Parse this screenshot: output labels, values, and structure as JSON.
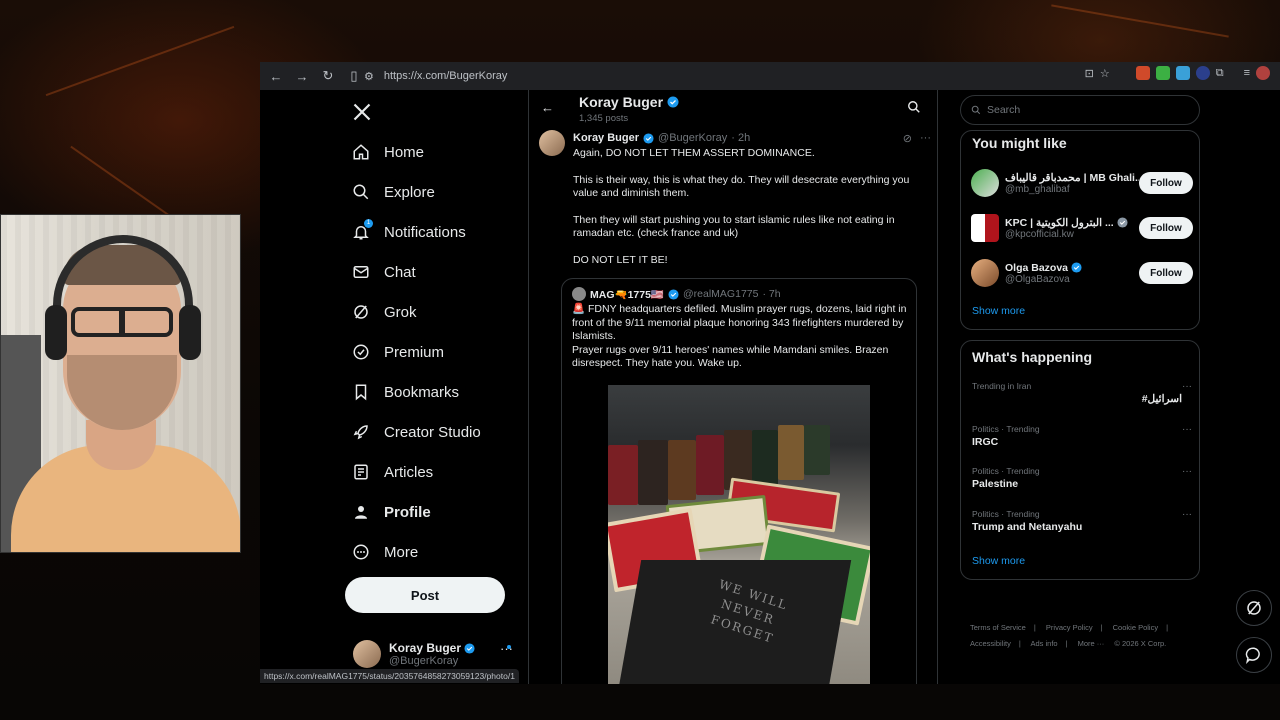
{
  "browser": {
    "url": "https://x.com/BugerKoray",
    "status_url": "https://x.com/realMAG1775/status/2035764858273059123/photo/1"
  },
  "nav": {
    "items": [
      {
        "label": "Home",
        "icon": "home-icon"
      },
      {
        "label": "Explore",
        "icon": "search-icon"
      },
      {
        "label": "Notifications",
        "icon": "bell-icon",
        "badge": "1"
      },
      {
        "label": "Chat",
        "icon": "mail-icon"
      },
      {
        "label": "Grok",
        "icon": "grok-icon"
      },
      {
        "label": "Premium",
        "icon": "verified-icon"
      },
      {
        "label": "Bookmarks",
        "icon": "bookmark-icon"
      },
      {
        "label": "Creator Studio",
        "icon": "rocket-icon"
      },
      {
        "label": "Articles",
        "icon": "article-icon"
      },
      {
        "label": "Profile",
        "icon": "person-icon"
      },
      {
        "label": "More",
        "icon": "more-circle-icon"
      }
    ],
    "post_label": "Post",
    "me": {
      "name": "Koray Buger",
      "handle": "@BugerKoray"
    }
  },
  "profile_header": {
    "name": "Koray Buger",
    "posts": "1,345 posts"
  },
  "tweet": {
    "name": "Koray Buger",
    "handle": "@BugerKoray",
    "time": "· 2h",
    "paragraphs": [
      "Again, DO NOT LET THEM ASSERT DOMINANCE.",
      "This is their way, this is what they do. They will desecrate everything you value and diminish them.",
      "Then they will start pushing you to start islamic rules like not eating in ramadan etc. (check france and uk)",
      "DO NOT LET IT BE!"
    ],
    "quote": {
      "name": "MAG🔫1775🇺🇸",
      "handle": "@realMAG1775",
      "time": "· 7h",
      "text1": "🚨 FDNY headquarters defiled. Muslim prayer rugs, dozens, laid right in front of the 9/11 memorial plaque honoring 343 firefighters murdered by Islamists.",
      "text2": "Prayer rugs over 9/11 heroes' names while Mamdani smiles. Brazen disrespect. They hate you. Wake up.",
      "plaque_lines": [
        "WE WILL",
        "NEVER",
        "FORGET"
      ]
    }
  },
  "right": {
    "search_placeholder": "Search",
    "wtf_title": "You might like",
    "wtf": [
      {
        "name": "محمدباقر قالیباف | MB Ghali...",
        "handle": "@mb_ghalibaf",
        "button": "Follow"
      },
      {
        "name": "KPC | البترول الكويتية ...",
        "handle": "@kpcofficial.kw",
        "button": "Follow"
      },
      {
        "name": "Olga Bazova",
        "handle": "@OlgaBazova",
        "button": "Follow"
      }
    ],
    "wtf_show_more": "Show more",
    "happening_title": "What's happening",
    "trends": [
      {
        "context": "Trending in Iran",
        "title": "#اسرائیل"
      },
      {
        "context": "Politics · Trending",
        "title": "IRGC"
      },
      {
        "context": "Politics · Trending",
        "title": "Palestine"
      },
      {
        "context": "Politics · Trending",
        "title": "Trump and Netanyahu"
      }
    ],
    "trends_show_more": "Show more",
    "footer": [
      "Terms of Service",
      "|",
      "Privacy Policy",
      "|",
      "Cookie Policy",
      "|",
      "Accessibility",
      "|",
      "Ads info",
      "|",
      "More ···",
      "© 2026 X Corp."
    ]
  }
}
